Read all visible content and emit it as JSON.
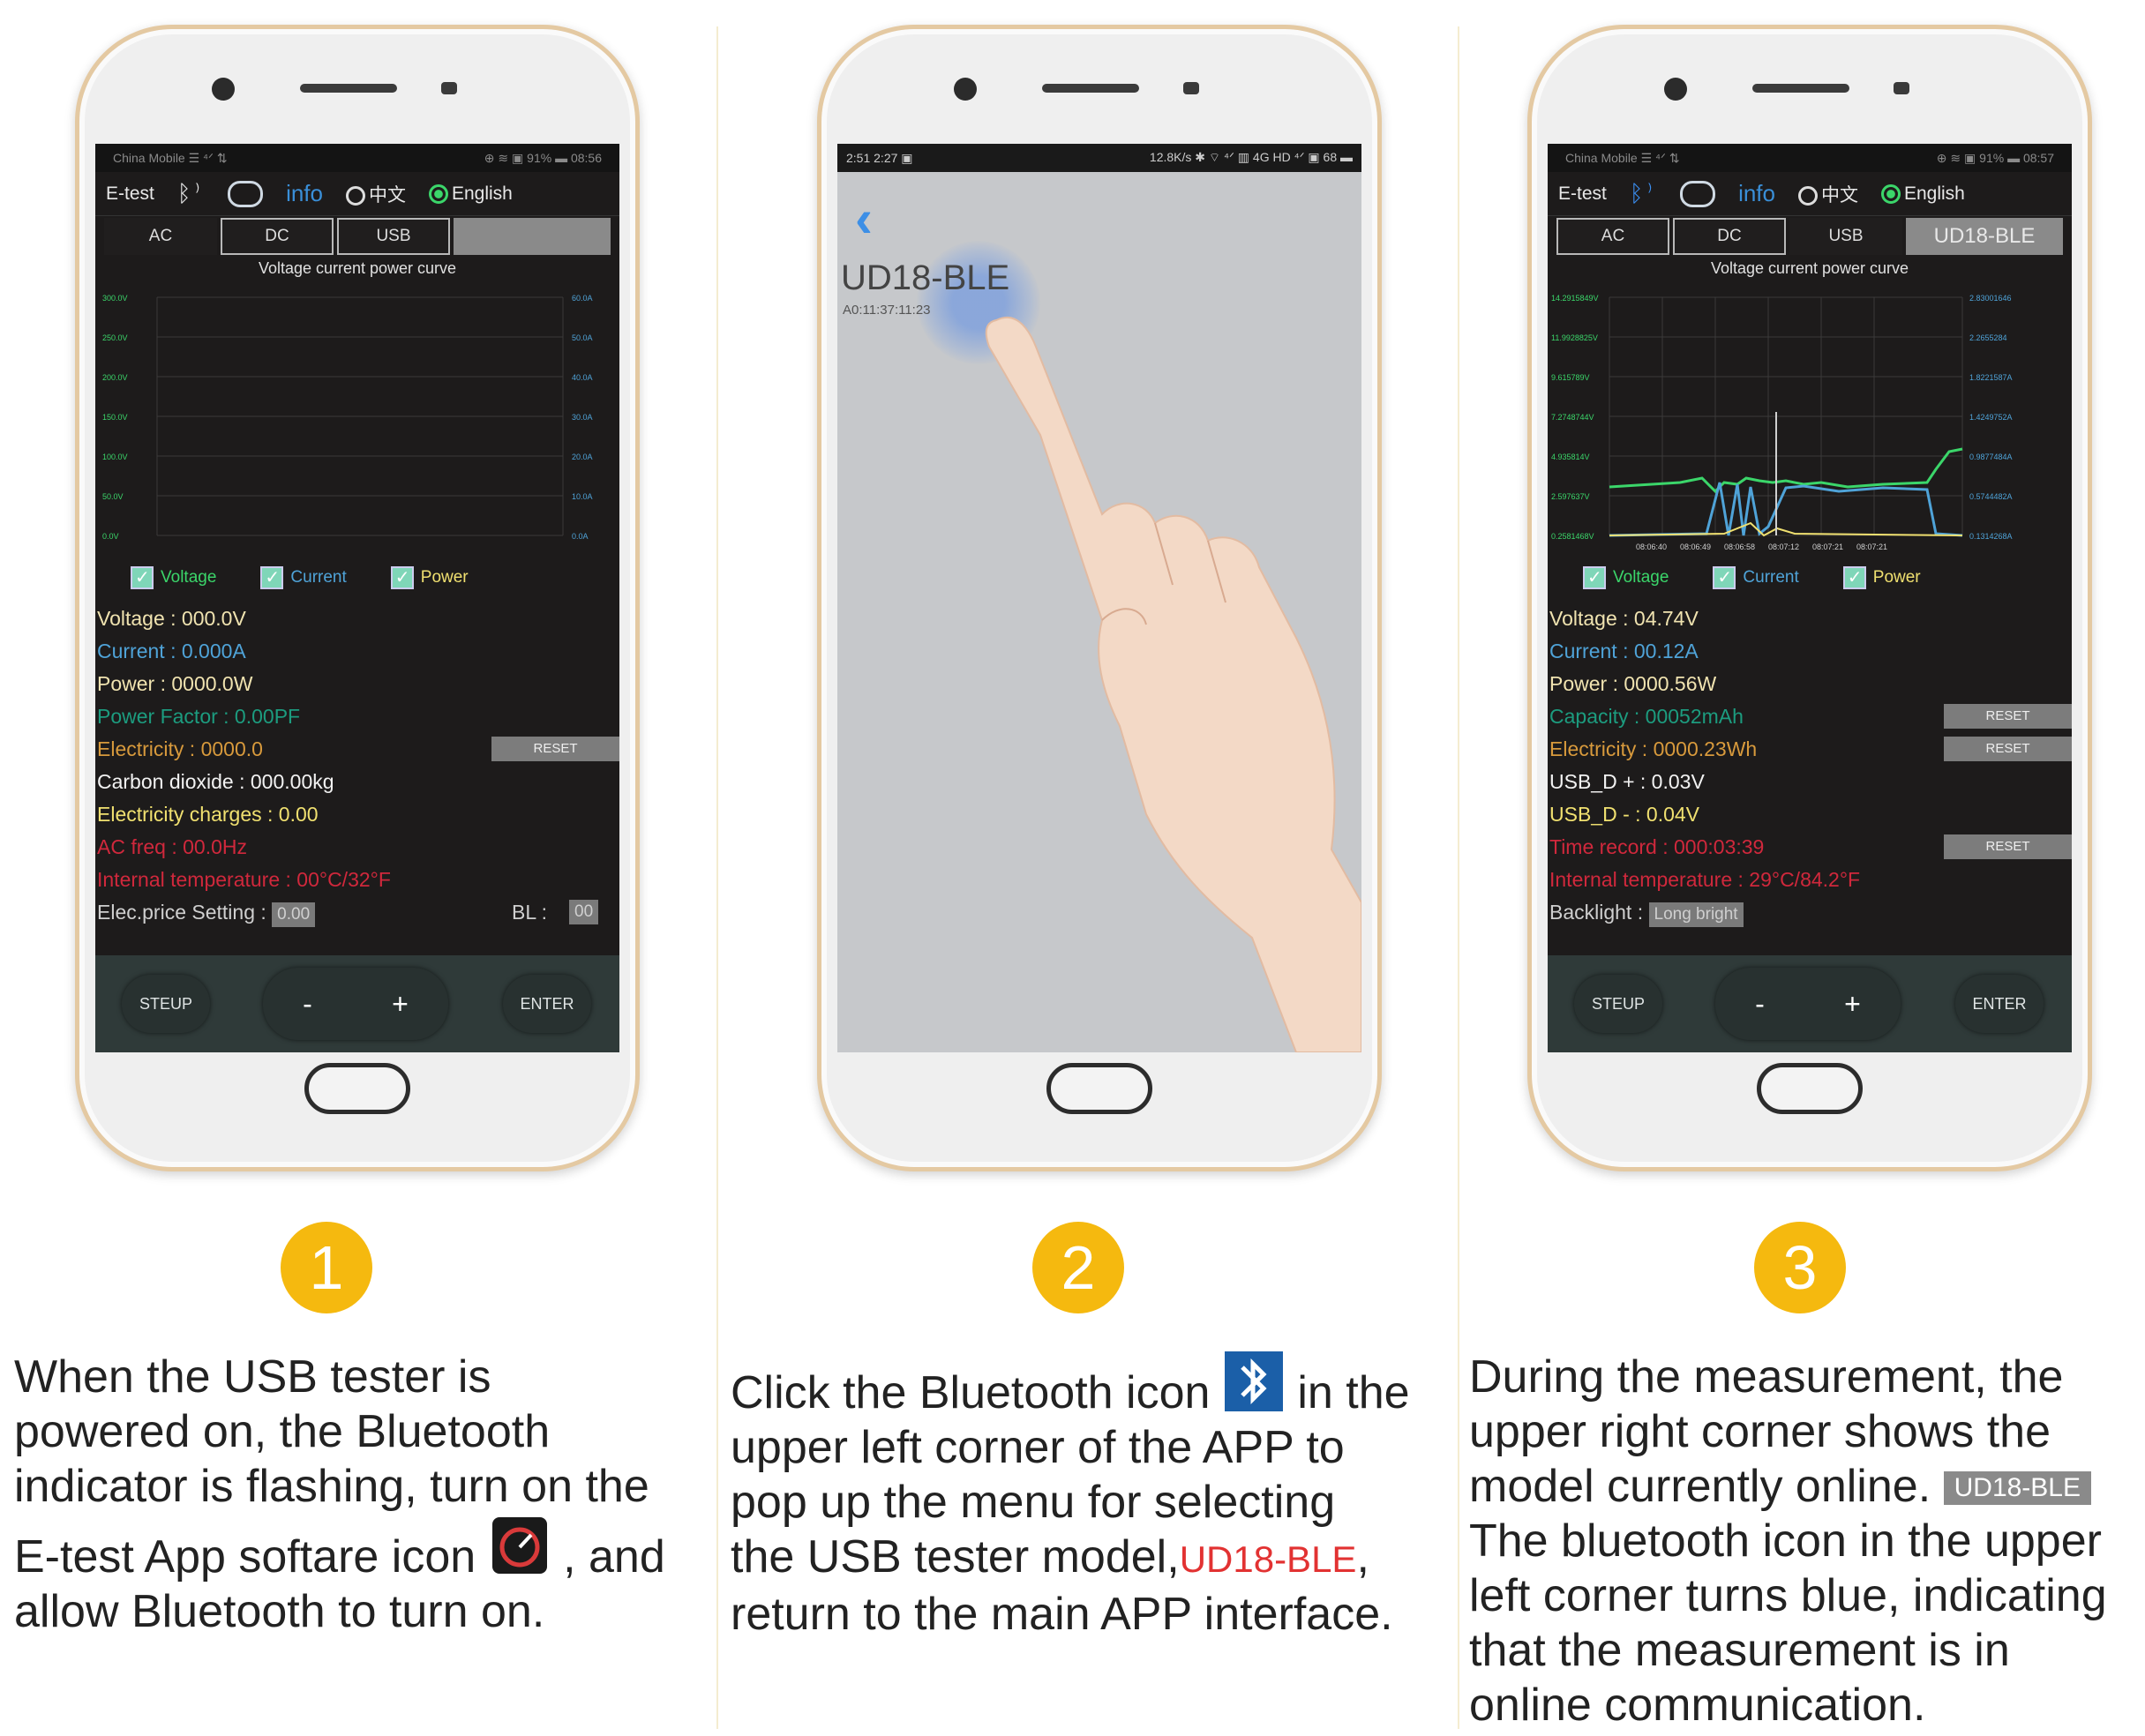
{
  "steps": [
    {
      "number": "1",
      "caption": {
        "line1": "When the USB tester is",
        "line2": "powered on, the Bluetooth",
        "line3": "indicator is flashing, turn on the",
        "line4a": "E-test App softare icon",
        "line4b": ", and",
        "line5": "allow Bluetooth to turn on."
      }
    },
    {
      "number": "2",
      "caption": {
        "line1a": "Click the Bluetooth icon",
        "line1b": "in the",
        "line2": "upper left corner of the APP to",
        "line3": "pop up the menu for selecting",
        "line4a": "the USB tester model,",
        "line4b": "UD18-BLE",
        "line4c": ",",
        "line5": "return to the main APP interface."
      }
    },
    {
      "number": "3",
      "caption": {
        "line1": "During the measurement, the",
        "line2": "upper right corner shows the",
        "line3a": "model currently online.",
        "line3b": "UD18-BLE",
        "line4": "The bluetooth icon in the upper",
        "line5": "left corner turns blue, indicating",
        "line6": "that the measurement is in",
        "line7": "online communication."
      }
    }
  ],
  "phone1": {
    "status_left": "China Mobile ☰ ⁴ᐟ ⇅",
    "status_right": "⊕ ≋ ▣ 91% ▬ 08:56",
    "app_title": "E-test",
    "bt_icon": "bluetooth-icon",
    "info_label": "info",
    "lang_cn": "中文",
    "lang_en": "English",
    "tabs": [
      "AC",
      "DC",
      "USB"
    ],
    "curve_title": "Voltage current power curve",
    "checks": [
      "Voltage",
      "Current",
      "Power"
    ],
    "readings": [
      {
        "text": "Voltage : 000.0V",
        "color": "#f0e3b0"
      },
      {
        "text": "Current : 0.000A",
        "color": "#4fa3d8"
      },
      {
        "text": "Power : 0000.0W",
        "color": "#f0e3b0"
      },
      {
        "text": "Power Factor : 0.00PF",
        "color": "#1c9c7f"
      },
      {
        "text": "Electricity : 0000.0",
        "color": "#d89a3c"
      },
      {
        "text": "Carbon dioxide : 000.00kg",
        "color": "#f2f2f2"
      },
      {
        "text": "Electricity charges : 0.00",
        "color": "#f0e070"
      },
      {
        "text": "AC freq : 00.0Hz",
        "color": "#d0283c"
      },
      {
        "text": "Internal temperature : 00°C/32°F",
        "color": "#d0283c"
      }
    ],
    "reset_label": "RESET",
    "price_label": "Elec.price Setting :",
    "price_value": "0.00",
    "bl_label": "BL :",
    "bl_value": "00",
    "buttons": {
      "setup": "STEUP",
      "minus": "-",
      "plus": "+",
      "enter": "ENTER"
    }
  },
  "phone2": {
    "status_left": "2:51 2:27 ▣",
    "status_right": "12.8K/s ✱ ⌔ ⁴ᐟ ▥ 4G HD ⁴ᐟ ▣ 68 ▬",
    "back_icon": "back-arrow-icon",
    "device_name": "UD18-BLE",
    "device_addr": "A0:11:37:11:23"
  },
  "phone3": {
    "status_left": "China Mobile ☰ ⁴ᐟ ⇅",
    "status_right": "⊕ ≋ ▣ 91% ▬ 08:57",
    "app_title": "E-test",
    "info_label": "info",
    "lang_cn": "中文",
    "lang_en": "English",
    "tabs": [
      "AC",
      "DC",
      "USB"
    ],
    "model_online": "UD18-BLE",
    "curve_title": "Voltage current power curve",
    "checks": [
      "Voltage",
      "Current",
      "Power"
    ],
    "readings": [
      {
        "text": "Voltage : 04.74V",
        "color": "#f0e3b0",
        "btn": ""
      },
      {
        "text": "Current : 00.12A",
        "color": "#4fa3d8",
        "btn": ""
      },
      {
        "text": "Power : 0000.56W",
        "color": "#f0e3b0",
        "btn": ""
      },
      {
        "text": "Capacity : 00052mAh",
        "color": "#1c9c7f",
        "btn": "RESET"
      },
      {
        "text": "Electricity : 0000.23Wh",
        "color": "#d89a3c",
        "btn": "RESET"
      },
      {
        "text": "USB_D + : 0.03V",
        "color": "#f2f2f2",
        "btn": ""
      },
      {
        "text": "USB_D - : 0.04V",
        "color": "#f0e070",
        "btn": ""
      },
      {
        "text": "Time record : 000:03:39",
        "color": "#d0283c",
        "btn": "RESET"
      },
      {
        "text": "Internal temperature : 29°C/84.2°F",
        "color": "#d0283c",
        "btn": ""
      }
    ],
    "backlight_label": "Backlight :",
    "backlight_value": "Long bright",
    "buttons": {
      "setup": "STEUP",
      "minus": "-",
      "plus": "+",
      "enter": "ENTER"
    }
  },
  "colors": {
    "badge": "#f5b90f",
    "bt_active": "#3b8ef0",
    "voltage": "#3bd66a",
    "current": "#4fa3d8",
    "power": "#f0e070"
  }
}
